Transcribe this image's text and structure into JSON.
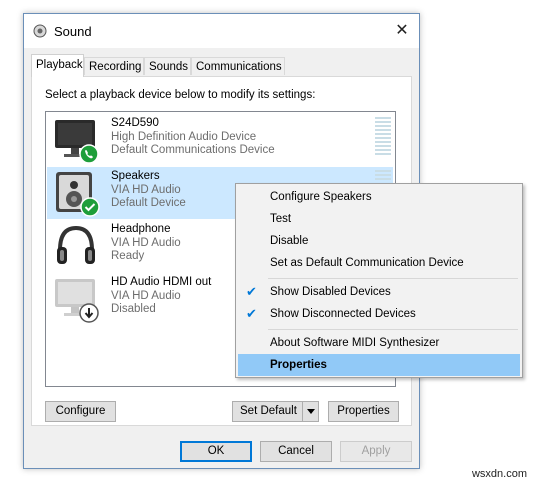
{
  "window": {
    "title": "Sound",
    "close_glyph": "✕"
  },
  "tabs": [
    {
      "label": "Playback",
      "active": true
    },
    {
      "label": "Recording",
      "active": false
    },
    {
      "label": "Sounds",
      "active": false
    },
    {
      "label": "Communications",
      "active": false
    }
  ],
  "playback": {
    "instruction": "Select a playback device below to modify its settings:",
    "devices": [
      {
        "name": "S24D590",
        "line1": "High Definition Audio Device",
        "line2": "Default Communications Device",
        "icon": "monitor-icon",
        "badge": "phone-badge-icon"
      },
      {
        "name": "Speakers",
        "line1": "VIA HD Audio",
        "line2": "Default Device",
        "icon": "speaker-icon",
        "badge": "check-badge-icon",
        "selected": true
      },
      {
        "name": "Headphone",
        "line1": "VIA HD Audio",
        "line2": "Ready",
        "icon": "headphone-icon"
      },
      {
        "name": "HD Audio HDMI out",
        "line1": "VIA HD Audio",
        "line2": "Disabled",
        "icon": "disabled-monitor-icon",
        "badge": "down-arrow-badge-icon"
      }
    ],
    "buttons": {
      "configure": "Configure",
      "set_default": "Set Default",
      "properties": "Properties"
    }
  },
  "dialog_buttons": {
    "ok": "OK",
    "cancel": "Cancel",
    "apply": "Apply"
  },
  "context_menu": {
    "items": [
      {
        "label": "Configure Speakers"
      },
      {
        "label": "Test"
      },
      {
        "label": "Disable"
      },
      {
        "label": "Set as Default Communication Device"
      },
      {
        "label": "Show Disabled Devices",
        "checked": true
      },
      {
        "label": "Show Disconnected Devices",
        "checked": true
      },
      {
        "label": "About Software MIDI Synthesizer"
      },
      {
        "label": "Properties",
        "highlighted": true,
        "bold": true
      }
    ],
    "check_glyph": "✔"
  },
  "watermark": "wsxdn.com",
  "colors": {
    "selection": "#cce8ff",
    "menu_highlight": "#91c9f7",
    "accent": "#0078d7",
    "badge_green": "#1e9e3a"
  }
}
